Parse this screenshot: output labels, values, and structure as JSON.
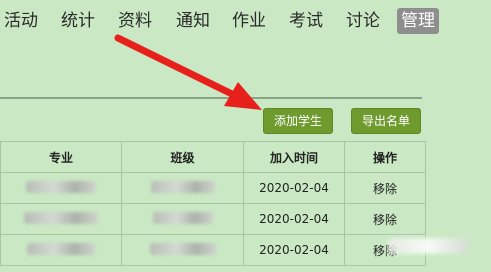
{
  "nav": {
    "items": [
      {
        "label": "活动"
      },
      {
        "label": "统计"
      },
      {
        "label": "资料"
      },
      {
        "label": "通知"
      },
      {
        "label": "作业"
      },
      {
        "label": "考试"
      },
      {
        "label": "讨论"
      },
      {
        "label": "管理",
        "active": true
      }
    ]
  },
  "toolbar": {
    "add_student_label": "添加学生",
    "export_list_label": "导出名单"
  },
  "table": {
    "headers": {
      "major": "专业",
      "class": "班级",
      "joined": "加入时间",
      "action": "操作"
    },
    "rows": [
      {
        "joined": "2020-02-04",
        "action": "移除"
      },
      {
        "joined": "2020-02-04",
        "action": "移除"
      },
      {
        "joined": "2020-02-04",
        "action": "移除"
      }
    ]
  },
  "colors": {
    "background": "#c9e8c3",
    "button": "#6f9a2e",
    "nav_active": "#8e8e8e",
    "annotation_arrow": "#e8201c"
  },
  "annotation": {
    "icon": "red-arrow-icon"
  }
}
